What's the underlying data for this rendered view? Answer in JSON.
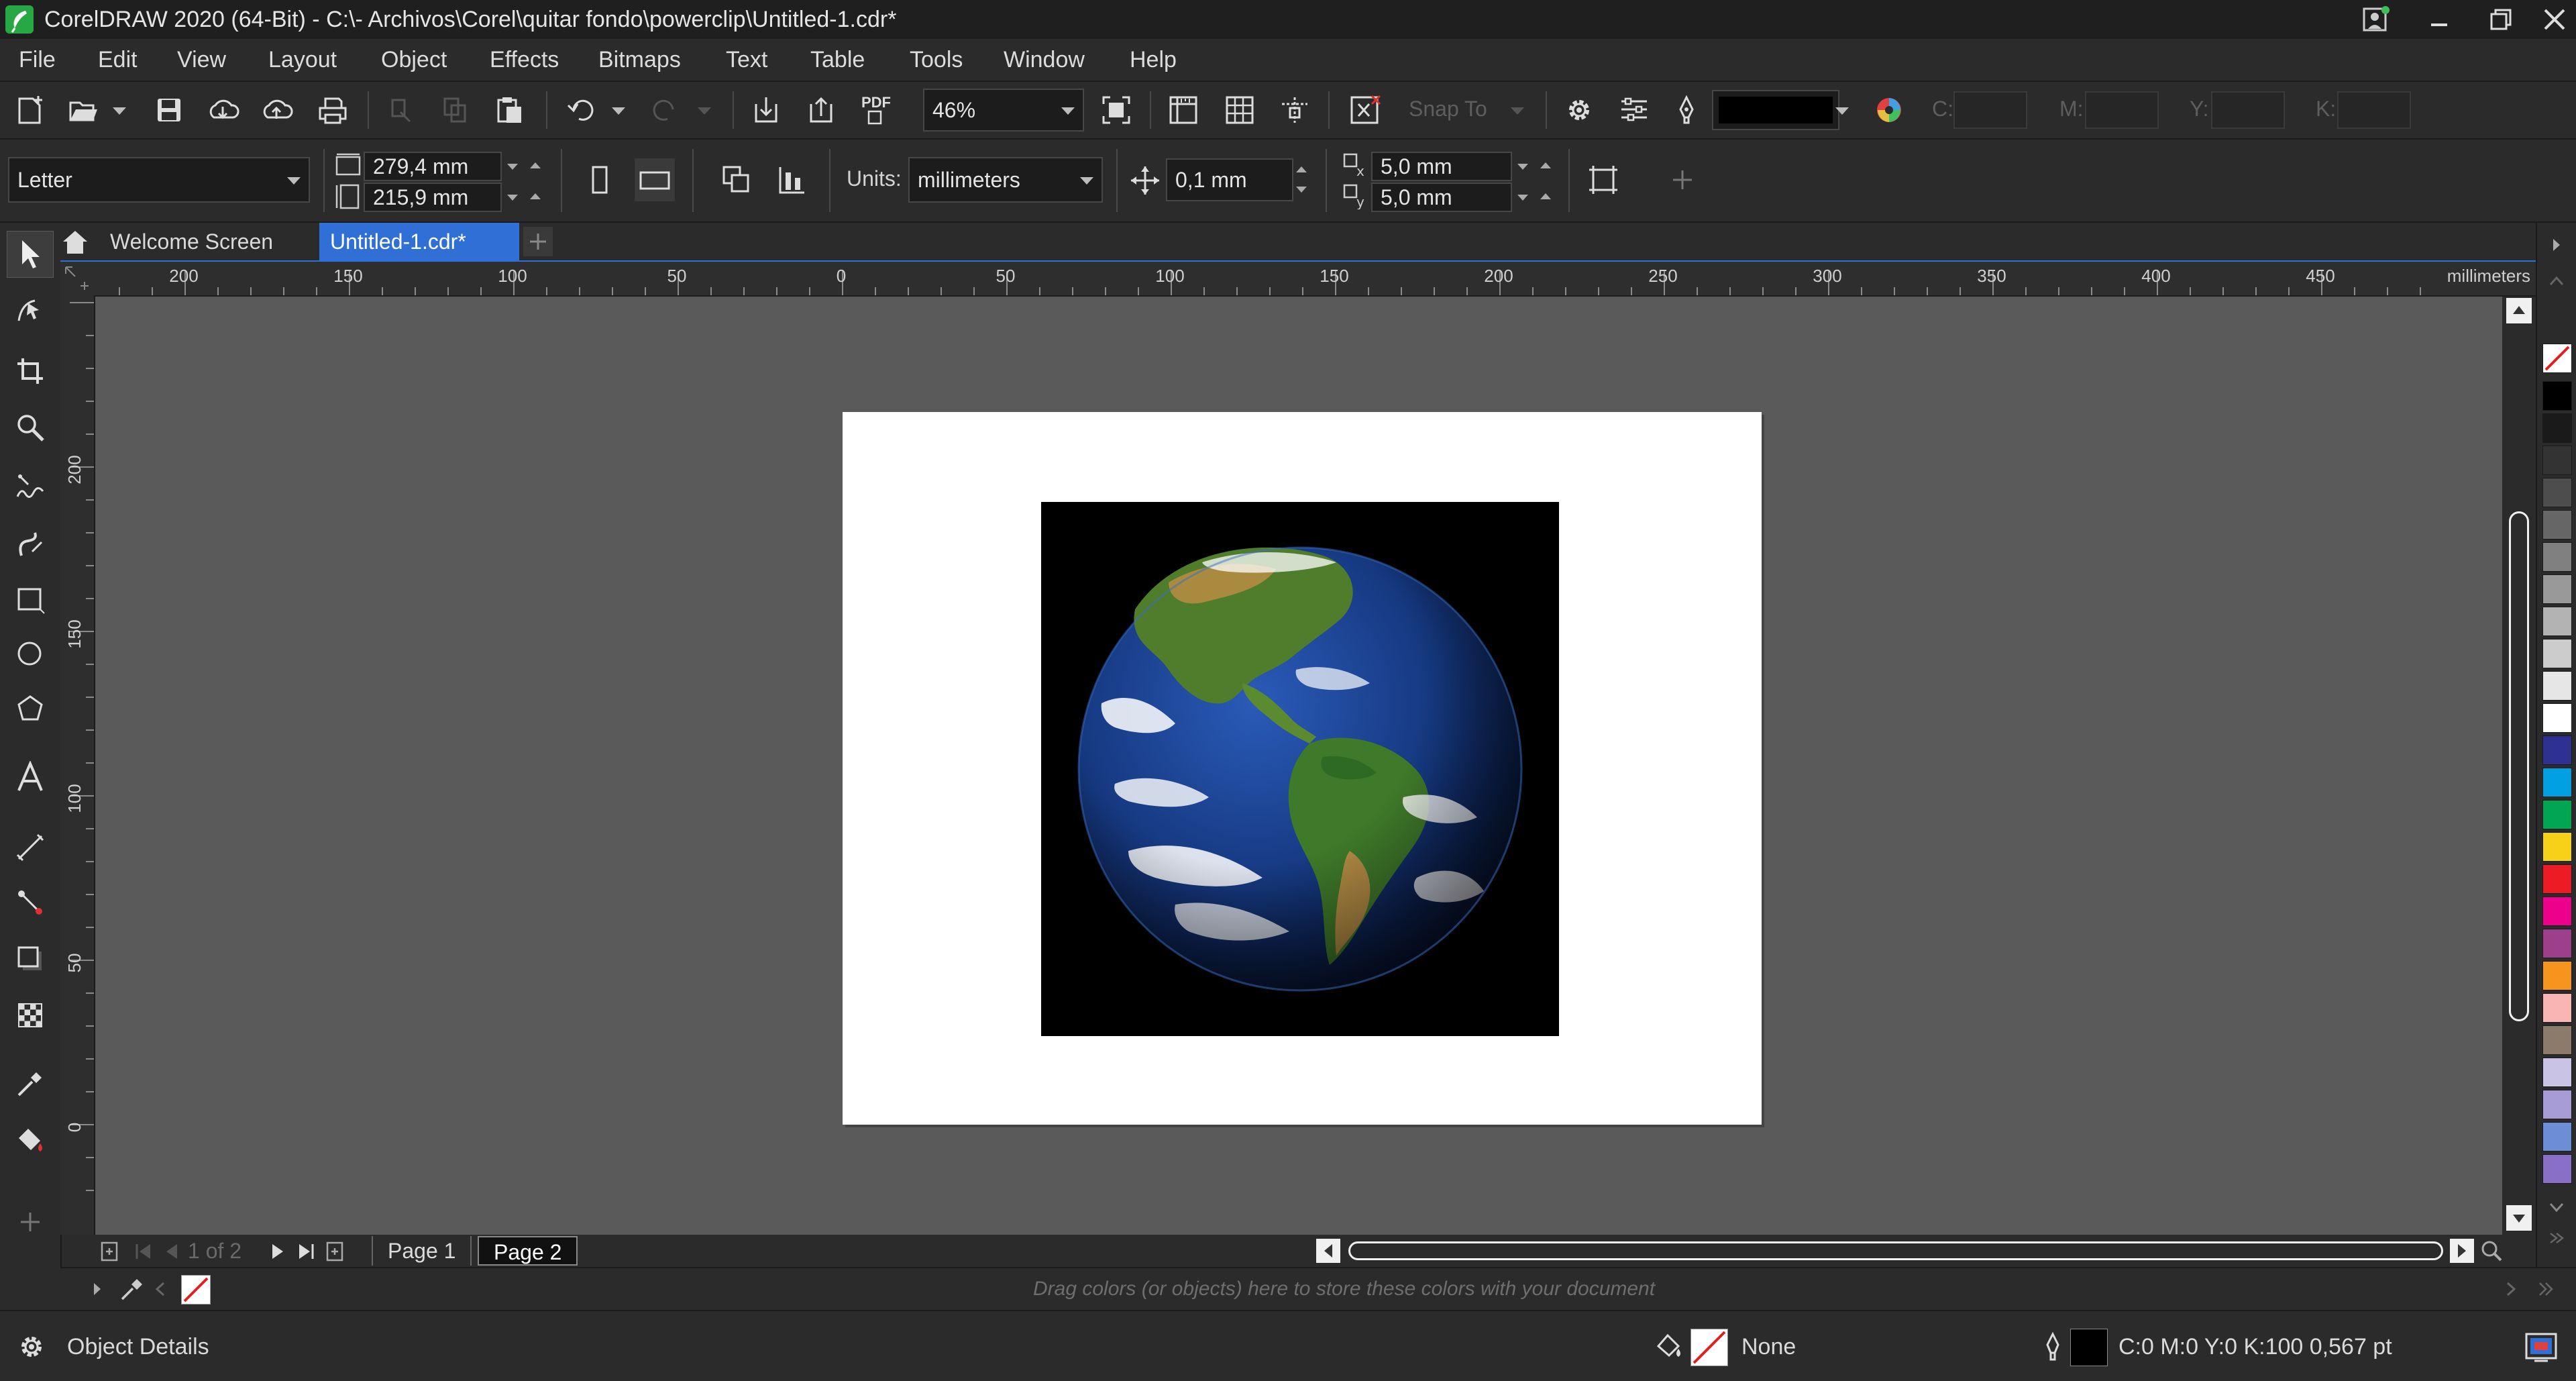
{
  "window": {
    "title": "CorelDRAW 2020 (64-Bit) - C:\\- Archivos\\Corel\\quitar fondo\\powerclip\\Untitled-1.cdr*"
  },
  "menu": {
    "items": [
      "File",
      "Edit",
      "View",
      "Layout",
      "Object",
      "Effects",
      "Bitmaps",
      "Text",
      "Table",
      "Tools",
      "Window",
      "Help"
    ]
  },
  "standard_toolbar": {
    "zoom_value": "46%",
    "snap_to_label": "Snap To",
    "pdf_label": "PDF",
    "cmyk": {
      "c_label": "C:",
      "m_label": "M:",
      "y_label": "Y:",
      "k_label": "K:"
    }
  },
  "property_bar": {
    "page_size": "Letter",
    "page_width": "279,4 mm",
    "page_height": "215,9 mm",
    "units_label": "Units:",
    "units_value": "millimeters",
    "nudge_value": "0,1 mm",
    "duplicate_x": "5,0 mm",
    "duplicate_y": "5,0 mm"
  },
  "tabs": {
    "welcome": "Welcome Screen",
    "document": "Untitled-1.cdr*"
  },
  "ruler": {
    "units": "millimeters",
    "h_ticks": [
      "200",
      "150",
      "100",
      "50",
      "0",
      "50",
      "100",
      "150",
      "200",
      "250",
      "300",
      "350",
      "400",
      "450"
    ],
    "v_ticks": [
      "200",
      "150",
      "100",
      "50",
      "0"
    ]
  },
  "page_nav": {
    "current": "1",
    "of_label": "of",
    "total": "2",
    "pages": [
      "Page 1",
      "Page 2"
    ]
  },
  "document_palette": {
    "hint": "Drag colors (or objects) here to store these colors with your document"
  },
  "status": {
    "object_details": "Object Details",
    "fill_label": "None",
    "outline_info": "C:0 M:0 Y:0 K:100  0,567 pt"
  },
  "colors": {
    "accent": "#2f6fd6",
    "canvas": "#5a5a5a",
    "page": "#ffffff",
    "palette": [
      "#000000",
      "#1a1a1a",
      "#333333",
      "#4d4d4d",
      "#666666",
      "#808080",
      "#999999",
      "#b3b3b3",
      "#cccccc",
      "#e6e6e6",
      "#ffffff",
      "#2e3192",
      "#00a0e3",
      "#00a651",
      "#f7d117",
      "#ed1c24",
      "#ec008c",
      "#9e3f8c",
      "#f7941d",
      "#f9b4b4",
      "#8c7b6b",
      "#c9c3e6",
      "#a79cd6",
      "#6b8ed6",
      "#8a6fc9"
    ]
  }
}
